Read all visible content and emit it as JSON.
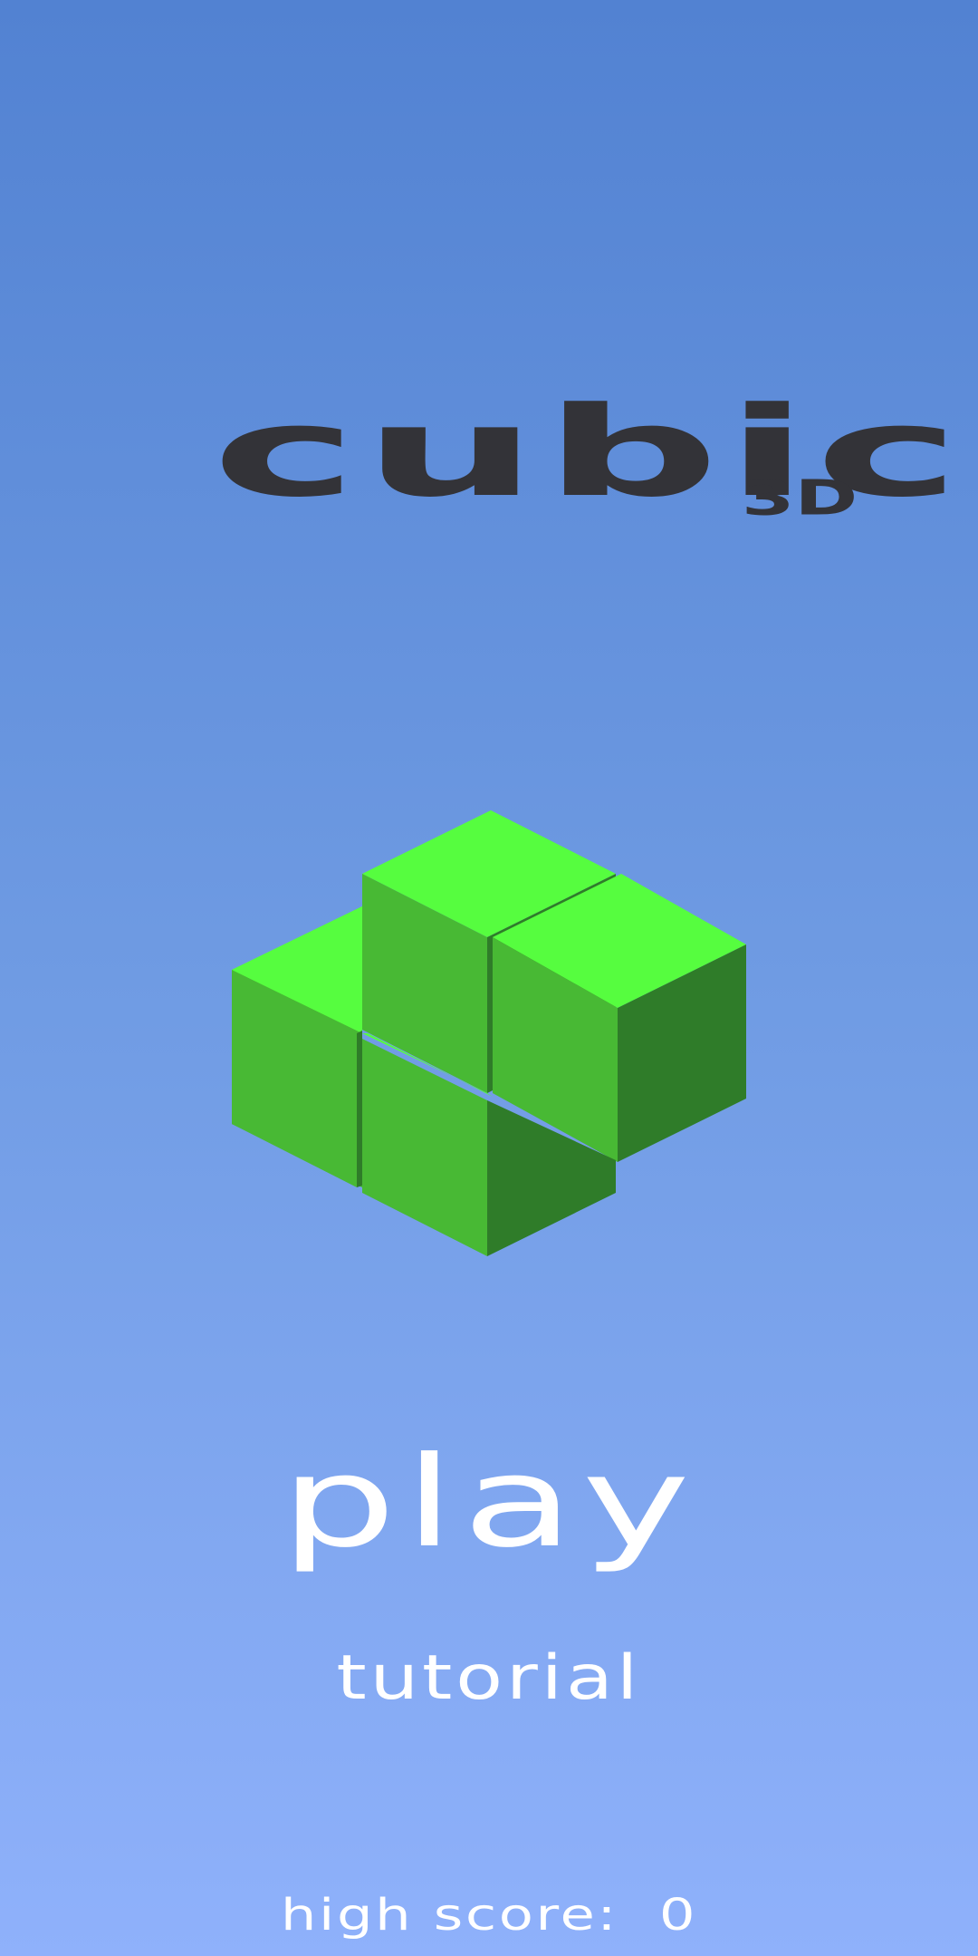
{
  "logo": {
    "title": "cubic",
    "suffix": "3D"
  },
  "menu": {
    "play_label": "play",
    "tutorial_label": "tutorial"
  },
  "high_score": {
    "label": "high score:",
    "value": "0"
  },
  "colors": {
    "background_top": "#5282d2",
    "background_bottom": "#8fb1fb",
    "logo_text": "#333338",
    "menu_text": "#ffffff",
    "cube_top": "#56fd3f",
    "cube_left": "#48b934",
    "cube_right": "#2f7c29"
  }
}
